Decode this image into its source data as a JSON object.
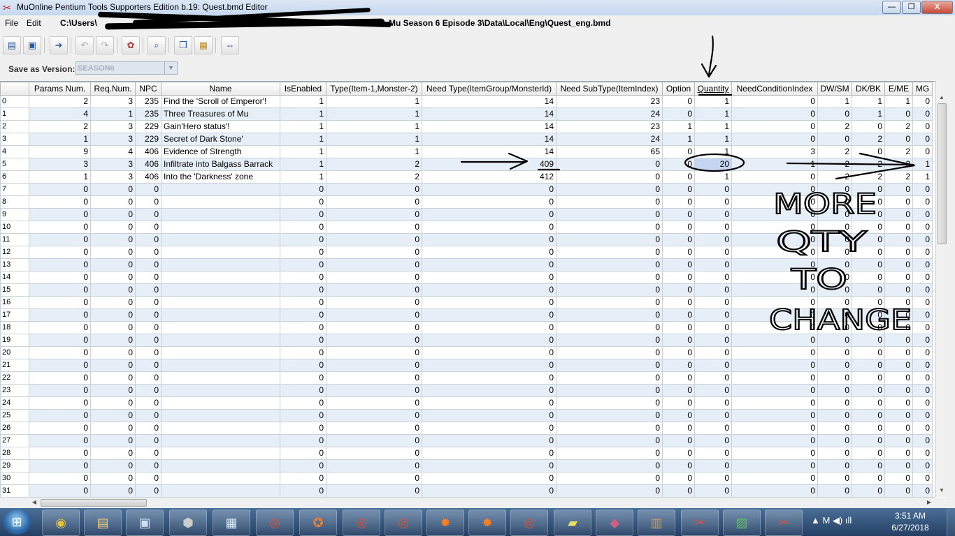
{
  "window": {
    "title": "MuOnline Pentium Tools Supporters Edition b.19: Quest.bmd Editor",
    "minimize": "—",
    "maximize": "❐",
    "close": "X"
  },
  "menu": {
    "items": [
      "File",
      "Edit"
    ],
    "path": "C:\\Users\\",
    "path_tail": "Mu Season 6 Episode 3\\Data\\Local\\Eng\\Quest_eng.bmd"
  },
  "toolbar": {
    "buttons": [
      "open-icon",
      "save-icon",
      "export-icon",
      "undo-icon",
      "redo-icon",
      "color-icon",
      "search-icon",
      "copy-icon",
      "paste-icon",
      "resize-icon"
    ]
  },
  "version": {
    "label": "Save as Version:",
    "value": "SEASON6"
  },
  "grid": {
    "columns": [
      "Params Num.",
      "Req.Num.",
      "NPC",
      "Name",
      "IsEnabled",
      "Type(Item-1,Monster-2)",
      "Need Type(ItemGroup/MonsterId)",
      "Need SubType(ItemIndex)",
      "Option",
      "Quantity",
      "NeedConditionIndex",
      "DW/SM",
      "DK/BK",
      "E/ME",
      "MG"
    ],
    "rows": [
      [
        "0",
        "2",
        "3",
        "235",
        "Find the 'Scroll of Emperor'!",
        "1",
        "1",
        "14",
        "23",
        "0",
        "1",
        "0",
        "1",
        "1",
        "1",
        "0"
      ],
      [
        "1",
        "4",
        "1",
        "235",
        "Three Treasures of Mu",
        "1",
        "1",
        "14",
        "24",
        "0",
        "1",
        "0",
        "0",
        "1",
        "0",
        "0"
      ],
      [
        "2",
        "2",
        "3",
        "229",
        "Gain'Hero status'!",
        "1",
        "1",
        "14",
        "23",
        "1",
        "1",
        "0",
        "2",
        "0",
        "2",
        "0"
      ],
      [
        "3",
        "1",
        "3",
        "229",
        "Secret of Dark Stone'",
        "1",
        "1",
        "14",
        "24",
        "1",
        "1",
        "0",
        "0",
        "2",
        "0",
        "0"
      ],
      [
        "4",
        "9",
        "4",
        "406",
        "Evidence of Strength",
        "1",
        "1",
        "14",
        "65",
        "0",
        "1",
        "3",
        "2",
        "0",
        "2",
        "0"
      ],
      [
        "5",
        "3",
        "3",
        "406",
        "Infiltrate into Balgass Barrack",
        "1",
        "2",
        "409",
        "0",
        "0",
        "20",
        "1",
        "2",
        "2",
        "2",
        "1"
      ],
      [
        "6",
        "1",
        "3",
        "406",
        "Into the 'Darkness' zone",
        "1",
        "2",
        "412",
        "0",
        "0",
        "1",
        "0",
        "2",
        "2",
        "2",
        "1"
      ]
    ],
    "empty_row_count": 25,
    "empty_value": "0"
  },
  "annotation": {
    "lines": [
      "MORE",
      "QTY",
      "TO",
      "CHANGE"
    ]
  },
  "taskbar": {
    "apps": [
      "chrome-icon",
      "explorer-icon",
      "remote-icon",
      "box-icon",
      "window-icon",
      "mu-icon",
      "app-icon",
      "mu-icon",
      "mu-icon",
      "emblem-icon",
      "emblem-icon",
      "mu-icon",
      "notes-icon",
      "shape-icon",
      "book-icon",
      "tools-icon",
      "chart-icon",
      "tools-icon"
    ],
    "tray": "▲ M ◀) ıll",
    "time": "3:51 AM",
    "date": "6/27/2018"
  }
}
